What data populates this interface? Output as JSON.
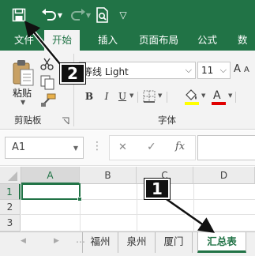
{
  "qat": {
    "more_glyph": "▽"
  },
  "tabs": [
    {
      "label": "文件"
    },
    {
      "label": "开始"
    },
    {
      "label": "插入"
    },
    {
      "label": "页面布局"
    },
    {
      "label": "公式"
    },
    {
      "label": "数据"
    }
  ],
  "ribbon": {
    "clipboard": {
      "paste_label": "粘贴",
      "group_label": "剪贴板"
    },
    "font": {
      "font_name": "等线 Light",
      "font_size": "11",
      "bold": "B",
      "italic": "I",
      "underline": "U",
      "group_label": "字体",
      "increase": "A",
      "decrease": "A"
    }
  },
  "formula_bar": {
    "name_box": "A1",
    "cancel": "✕",
    "enter": "✓",
    "fx": "fx"
  },
  "grid": {
    "columns": [
      "A",
      "B",
      "C",
      "D"
    ],
    "rows": [
      "1",
      "2",
      "3"
    ]
  },
  "sheets": [
    {
      "label": "福州"
    },
    {
      "label": "泉州"
    },
    {
      "label": "厦门"
    },
    {
      "label": "汇总表"
    }
  ],
  "callouts": {
    "one": "1",
    "two": "2"
  },
  "colors": {
    "brand": "#217346",
    "selection": "#217346",
    "active_tab_text": "#217346"
  }
}
